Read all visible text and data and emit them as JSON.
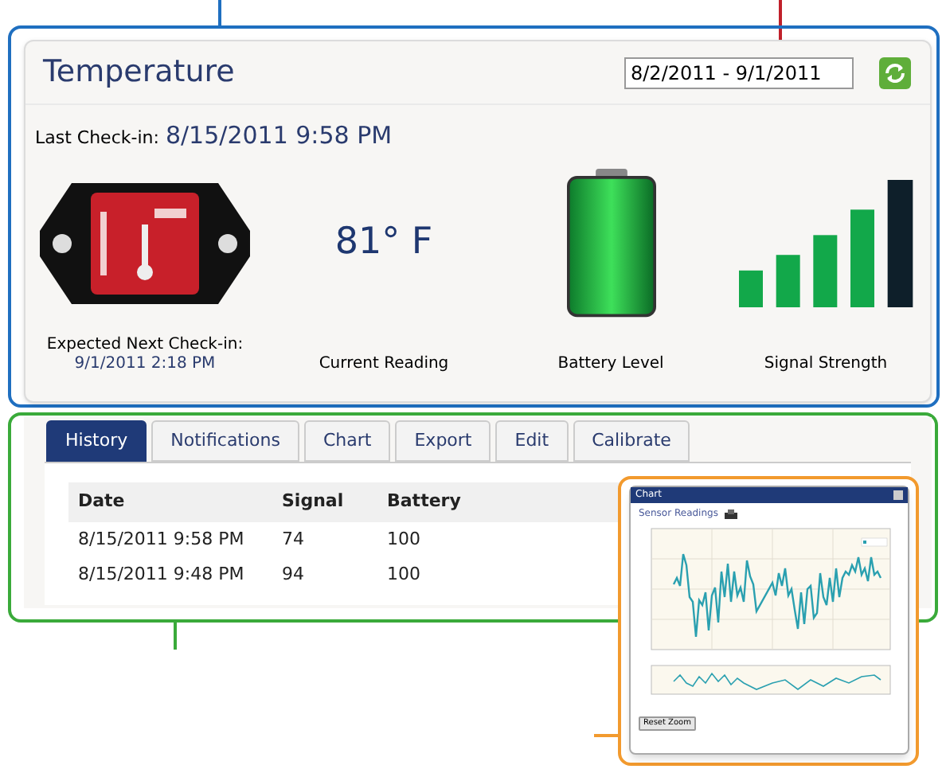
{
  "sensor": {
    "title": "Temperature",
    "date_range": "8/2/2011 - 9/1/2011",
    "last_check_in_label": "Last Check-in:",
    "last_check_in": "8/15/2011 9:58 PM",
    "reading": "81° F",
    "expected_label": "Expected Next Check-in:",
    "expected": "9/1/2011 2:18 PM",
    "reading_label": "Current Reading",
    "battery_label": "Battery Level",
    "signal_label": "Signal Strength"
  },
  "tabs": [
    {
      "label": "History",
      "selected": true
    },
    {
      "label": "Notifications",
      "selected": false
    },
    {
      "label": "Chart",
      "selected": false
    },
    {
      "label": "Export",
      "selected": false
    },
    {
      "label": "Edit",
      "selected": false
    },
    {
      "label": "Calibrate",
      "selected": false
    }
  ],
  "table": {
    "columns": [
      "Date",
      "Signal",
      "Battery"
    ],
    "rows": [
      [
        "8/15/2011 9:58 PM",
        "74",
        "100"
      ],
      [
        "8/15/2011 9:48 PM",
        "94",
        "100"
      ]
    ]
  },
  "chart_popup": {
    "title": "Chart",
    "heading": "Sensor Readings",
    "button": "Reset Zoom"
  }
}
